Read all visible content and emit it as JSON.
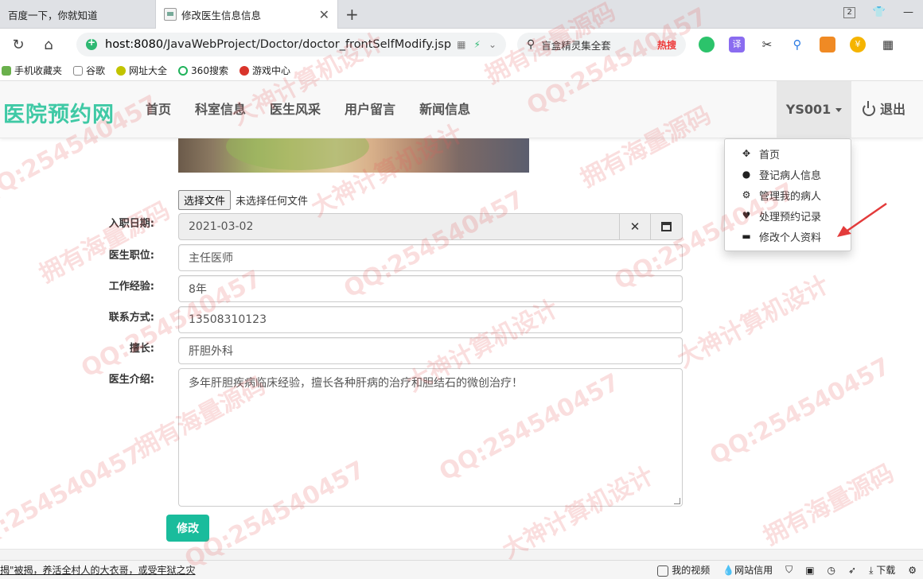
{
  "browser": {
    "tabs": [
      {
        "title": "百度一下，你就知道"
      },
      {
        "title": "修改医生信息信息"
      }
    ],
    "tab_count": "2",
    "url_host": "host:8080",
    "url_path": "/JavaWebProject/Doctor/doctor_frontSelfModify.jsp",
    "search_text": "盲盒精灵集全套",
    "search_badge": "热搜",
    "bookmarks": [
      "手机收藏夹",
      "谷歌",
      "网址大全",
      "360搜索",
      "游戏中心"
    ]
  },
  "site": {
    "brand": "医院预约网",
    "menu": [
      "首页",
      "科室信息",
      "医生风采",
      "用户留言",
      "新闻信息"
    ],
    "user": "YS001",
    "logout": "退出",
    "dropdown": [
      {
        "icon": "move-icon",
        "glyph": "✥",
        "label": "首页"
      },
      {
        "icon": "user-icon",
        "glyph": "👤",
        "label": "登记病人信息"
      },
      {
        "icon": "cog-icon",
        "glyph": "⚙",
        "label": "管理我的病人"
      },
      {
        "icon": "heart-icon",
        "glyph": "♥",
        "label": "处理预约记录"
      },
      {
        "icon": "credit-card-icon",
        "glyph": "▬",
        "label": "修改个人资料"
      }
    ]
  },
  "form": {
    "file_button": "选择文件",
    "file_status": "未选择任何文件",
    "hire_date_label": "入职日期:",
    "hire_date": "2021-03-02",
    "position_label": "医生职位:",
    "position": "主任医师",
    "experience_label": "工作经验:",
    "experience": "8年",
    "contact_label": "联系方式:",
    "contact": "13508310123",
    "specialty_label": "擅长:",
    "specialty": "肝胆外科",
    "intro_label": "医生介绍:",
    "intro": "多年肝胆疾病临床经验，擅长各种肝病的治疗和胆结石的微创治疗！",
    "submit": "修改"
  },
  "status": {
    "news": "揭\"被揭，养活全村人的大衣哥，或受牢狱之灾",
    "video": "我的视频",
    "credit": "网站信用",
    "download": "下载"
  },
  "watermarks": [
    "QQ:254540457",
    "拥有海量源码",
    "大神计算机设计"
  ],
  "colors": {
    "brand": "#3fc9a5",
    "submit": "#1abc9c",
    "arrow": "#e33b3b"
  }
}
